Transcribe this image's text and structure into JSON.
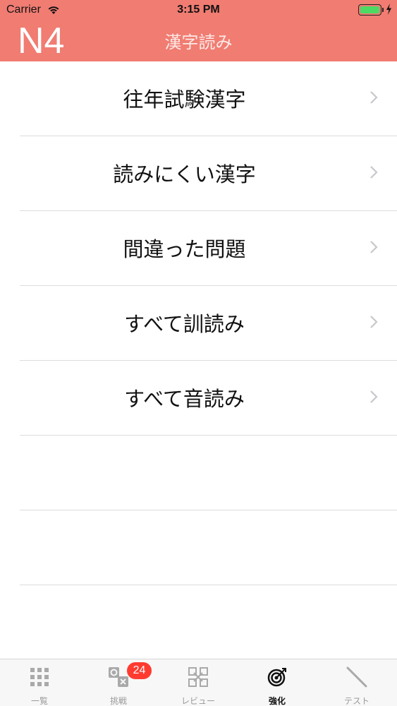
{
  "status_bar": {
    "carrier": "Carrier",
    "time": "3:15 PM"
  },
  "header": {
    "level": "N4",
    "title": "漢字読み"
  },
  "menu": {
    "items": [
      {
        "label": "往年試験漢字"
      },
      {
        "label": "読みにくい漢字"
      },
      {
        "label": "間違った問題"
      },
      {
        "label": "すべて訓読み"
      },
      {
        "label": "すべて音読み"
      }
    ]
  },
  "tabbar": {
    "tabs": [
      {
        "label": "一覧",
        "icon": "grid-icon"
      },
      {
        "label": "挑戦",
        "icon": "quiz-icon",
        "badge": "24"
      },
      {
        "label": "レビュー",
        "icon": "review-icon"
      },
      {
        "label": "強化",
        "icon": "target-icon",
        "active": true
      },
      {
        "label": "テスト",
        "icon": "pen-icon"
      }
    ]
  },
  "colors": {
    "header": "#f07c72",
    "badge": "#ff3b30",
    "battery": "#4cd964"
  }
}
